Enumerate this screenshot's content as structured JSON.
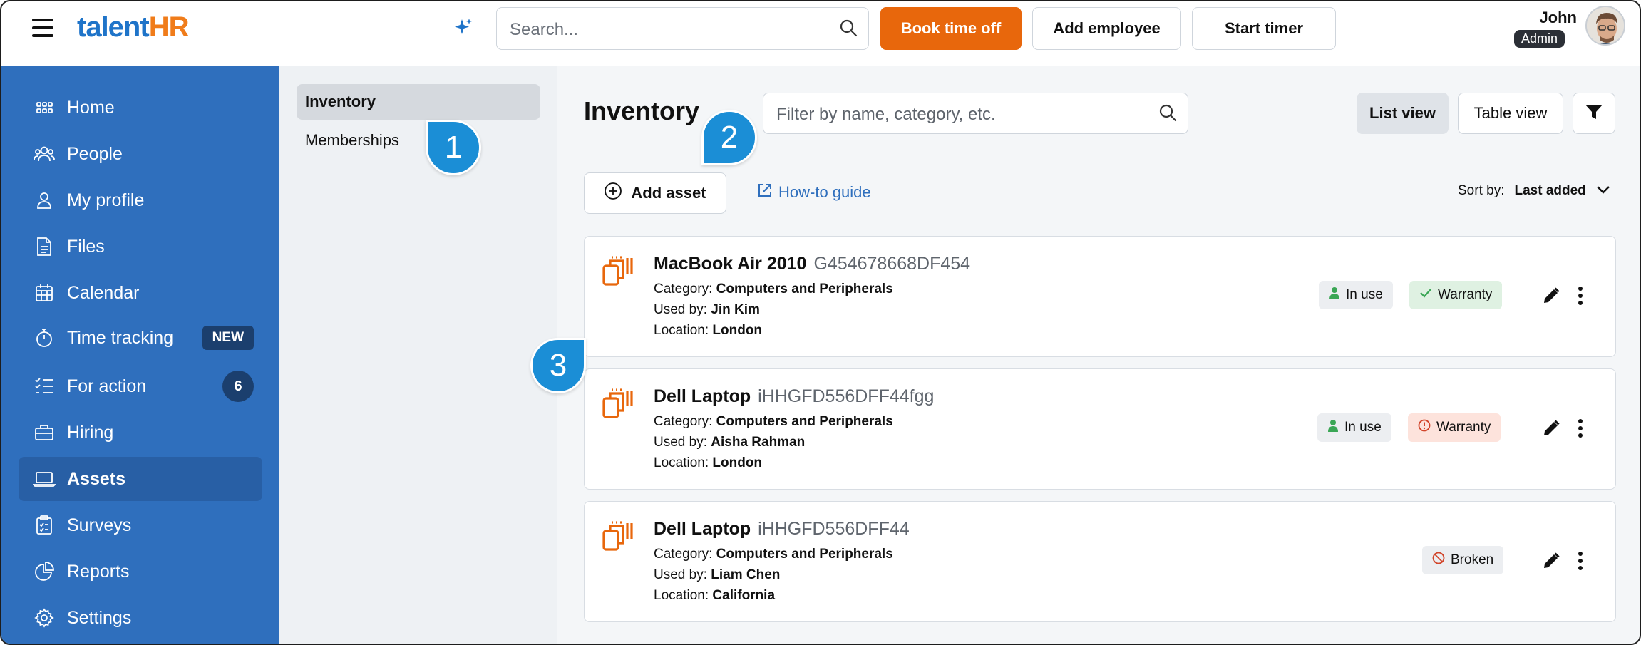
{
  "app": {
    "logo_part1": "talent",
    "logo_part2": "HR"
  },
  "topbar": {
    "search_placeholder": "Search...",
    "book_time_off": "Book time off",
    "add_employee": "Add employee",
    "start_timer": "Start timer",
    "user_name": "John",
    "user_role": "Admin"
  },
  "sidebar": {
    "items": [
      {
        "label": "Home",
        "icon": "home-grid-icon"
      },
      {
        "label": "People",
        "icon": "people-icon"
      },
      {
        "label": "My profile",
        "icon": "user-icon"
      },
      {
        "label": "Files",
        "icon": "file-icon"
      },
      {
        "label": "Calendar",
        "icon": "calendar-icon"
      },
      {
        "label": "Time tracking",
        "icon": "stopwatch-icon",
        "badge": "NEW"
      },
      {
        "label": "For action",
        "icon": "checklist-icon",
        "count": "6"
      },
      {
        "label": "Hiring",
        "icon": "briefcase-icon"
      },
      {
        "label": "Assets",
        "icon": "laptop-icon",
        "active": true
      },
      {
        "label": "Surveys",
        "icon": "clipboard-icon"
      },
      {
        "label": "Reports",
        "icon": "pie-chart-icon"
      },
      {
        "label": "Settings",
        "icon": "gear-icon"
      }
    ]
  },
  "subnav": {
    "items": [
      {
        "label": "Inventory",
        "active": true
      },
      {
        "label": "Memberships"
      }
    ]
  },
  "main": {
    "title": "Inventory",
    "filter_placeholder": "Filter by name, category, etc.",
    "list_view": "List view",
    "table_view": "Table view",
    "add_asset": "Add asset",
    "howto": "How-to guide",
    "sort_label": "Sort by:",
    "sort_value": "Last added"
  },
  "labels": {
    "category": "Category:",
    "used_by": "Used by:",
    "location": "Location:"
  },
  "assets": [
    {
      "name": "MacBook Air 2010",
      "serial": "G454678668DF454",
      "category": "Computers and Peripherals",
      "used_by": "Jin Kim",
      "location": "London",
      "status": "In use",
      "warranty": "Warranty",
      "warranty_state": "ok"
    },
    {
      "name": "Dell Laptop",
      "serial": "iHHGFD556DFF44fgg",
      "category": "Computers and Peripherals",
      "used_by": "Aisha Rahman",
      "location": "London",
      "status": "In use",
      "warranty": "Warranty",
      "warranty_state": "expired"
    },
    {
      "name": "Dell Laptop",
      "serial": "iHHGFD556DFF44",
      "category": "Computers and Peripherals",
      "used_by": "Liam Chen",
      "location": "California",
      "status": "Broken"
    }
  ],
  "callouts": [
    "1",
    "2",
    "3"
  ],
  "colors": {
    "brand_blue": "#2f6fbd",
    "brand_orange": "#e8670c",
    "callout_blue": "#1b8ed6"
  }
}
